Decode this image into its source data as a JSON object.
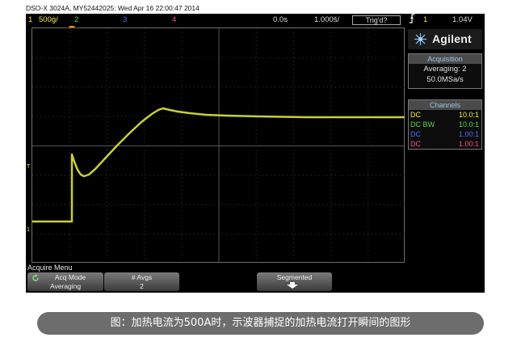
{
  "header": {
    "device_line": "DSO-X 3024A, MY52442025: Wed Apr 16 22:00:47 2014"
  },
  "status_bar": {
    "ch1_label": "1",
    "ch1_scale": "500ġ/",
    "ch2_label": "2",
    "ch3_label": "3",
    "ch4_label": "4",
    "time_delay": "0.0s",
    "time_scale": "1.000š/",
    "trigger_state": "Trig'd?",
    "trigger_source": "1",
    "trigger_level": "1.04V"
  },
  "panel": {
    "brand": "Agilent",
    "acquisition_title": "Acquisition",
    "acquisition_mode": "Averaging: 2",
    "sample_rate": "50.0MSa/s",
    "channels_title": "Channels",
    "channels": [
      {
        "coupling": "DC",
        "probe": "10.0:1",
        "color": "#f2e84a"
      },
      {
        "coupling": "DC BW",
        "probe": "10.0:1",
        "color": "#53d84f"
      },
      {
        "coupling": "DC",
        "probe": "1.00:1",
        "color": "#5668ff"
      },
      {
        "coupling": "DC",
        "probe": "1.00:1",
        "color": "#ff4b7d"
      }
    ]
  },
  "markers": {
    "trigger_level_marker": "T",
    "ground_marker": "1"
  },
  "menu": {
    "title": "Acquire Menu",
    "softkeys": [
      {
        "label": "Acq Mode",
        "value": "Averaging"
      },
      {
        "label": "# Avgs",
        "value": "2"
      },
      {
        "label": "Segmented",
        "value": ""
      }
    ]
  },
  "caption": {
    "text": "图：加热电流为500A时，示波器捕捉的加热电流打开瞬间的图形"
  },
  "colors": {
    "trace": "#c8cf3a",
    "ch1": "#f2e84a",
    "ch2": "#53d84f",
    "ch3": "#5668ff",
    "ch4": "#ff4b7d",
    "caption_bg": "#6d6d6d"
  }
}
